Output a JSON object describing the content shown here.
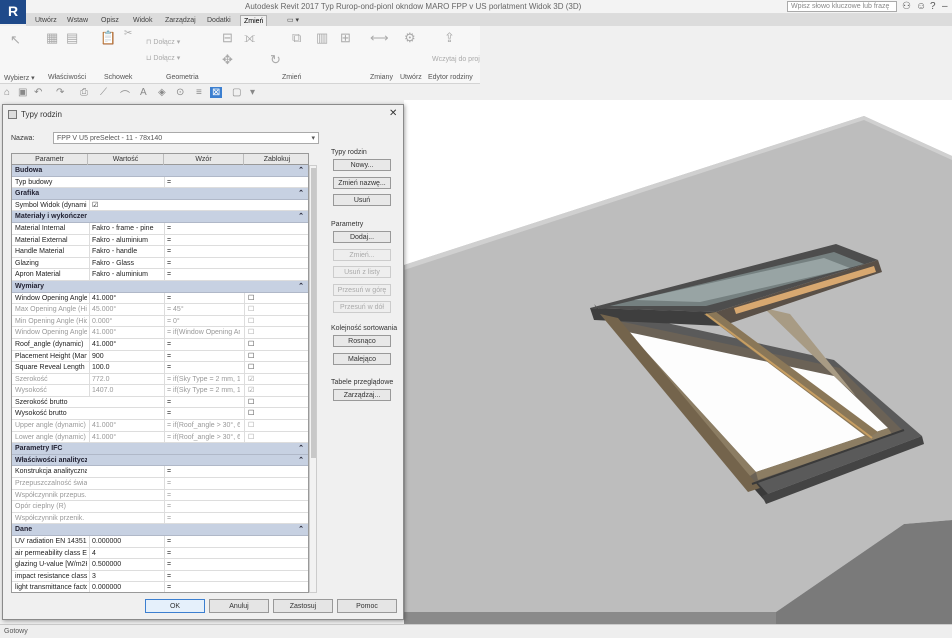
{
  "titlebar": {
    "logo": "R",
    "title": "Autodesk Revit 2017    Typ Rurop-ond-pionl okndow MARO FPP v US porlatment    Widok 3D (3D)",
    "search_placeholder": "Wpisz słowo kluczowe lub frazę"
  },
  "tabs": [
    "Utwórz",
    "Wstaw",
    "Opisz",
    "Widok",
    "Zarządzaj",
    "Dodatki",
    "Zmień"
  ],
  "active_tab": "Zmień",
  "ribbon": {
    "groups": [
      "Wybierz ▾",
      "Właściwości",
      "Schowek",
      "Geometria",
      "Zmień",
      "Zmiany",
      "Utwórz",
      "Edytor rodziny"
    ],
    "small_labels": [
      "Wczytaj do projektu"
    ]
  },
  "dialog": {
    "title": "Typy rodzin",
    "close": "✕",
    "rodzina_label": "Nazwa:",
    "rodzina_value": "FPP V U5 preSelect - 11 - 78x140",
    "headers": [
      "Parametr",
      "Wartość",
      "Wzór",
      "Zablokuj"
    ],
    "rows": [
      {
        "type": "grp",
        "c0": "Budowa"
      },
      {
        "c0": "Typ budowy",
        "c1": "",
        "c2": "="
      },
      {
        "type": "grp",
        "c0": "Grafika"
      },
      {
        "c0": "Symbol Widok (dynamic)",
        "c1": "☑",
        "c2": ""
      },
      {
        "type": "grp",
        "c0": "Materiały i wykończenia"
      },
      {
        "c0": "Material Internal",
        "c1": "Fakro - frame - pine",
        "c2": "="
      },
      {
        "c0": "Material External",
        "c1": "Fakro - aluminium",
        "c2": "="
      },
      {
        "c0": "Handle Material",
        "c1": "Fakro - handle",
        "c2": "="
      },
      {
        "c0": "Glazing",
        "c1": "Fakro - Glass",
        "c2": "="
      },
      {
        "c0": "Apron Material",
        "c1": "Fakro - aluminium",
        "c2": "="
      },
      {
        "type": "grp",
        "c0": "Wymiary"
      },
      {
        "c0": "Window Opening Angle",
        "c1": "41.000°",
        "c2": "=",
        "c3": "☐"
      },
      {
        "c0": "Max Opening Angle (Hidden)",
        "c1": "45.000°",
        "c2": "= 45°",
        "c3": "☐",
        "dim": true
      },
      {
        "c0": "Min Opening Angle (Hidden)",
        "c1": "0.000°",
        "c2": "= 0°",
        "c3": "☐",
        "dim": true
      },
      {
        "c0": "Window Opening Angle 2",
        "c1": "41.000°",
        "c2": "= if(Window Opening Angle",
        "c3": "☐",
        "dim": true
      },
      {
        "c0": "Roof_angle (dynamic)",
        "c1": "41.000°",
        "c2": "=",
        "c3": "☐"
      },
      {
        "c0": "Placement Height (Manual)",
        "c1": "900",
        "c2": "=",
        "c3": "☐"
      },
      {
        "c0": "Square Reveal Length",
        "c1": "100.0",
        "c2": "=",
        "c3": "☐"
      },
      {
        "c0": "Szerokość",
        "c1": "772.0",
        "c2": "= if(Sky Type = 2 mm, 1",
        "c3": "☑",
        "dim": true
      },
      {
        "c0": "Wysokość",
        "c1": "1407.0",
        "c2": "= if(Sky Type = 2 mm, 1",
        "c3": "☑",
        "dim": true
      },
      {
        "c0": "Szerokość brutto",
        "c1": "",
        "c2": "=",
        "c3": "☐"
      },
      {
        "c0": "Wysokość brutto",
        "c1": "",
        "c2": "=",
        "c3": "☐"
      },
      {
        "c0": "Upper angle (dynamic)",
        "c1": "41.000°",
        "c2": "= if(Roof_angle > 30°, 60",
        "c3": "☐",
        "dim": true
      },
      {
        "c0": "Lower angle (dynamic)",
        "c1": "41.000°",
        "c2": "= if(Roof_angle > 30°, 60",
        "c3": "☐",
        "dim": true
      },
      {
        "type": "grp",
        "c0": "Parametry IFC"
      },
      {
        "type": "grp",
        "c0": "Właściwości analityczne"
      },
      {
        "c0": "Konstrukcja analityczna",
        "c1": "",
        "c2": "="
      },
      {
        "c0": "Przepuszczalność światła",
        "c1": "",
        "c2": "=",
        "dim": true
      },
      {
        "c0": "Współczynnik przepus.",
        "c1": "",
        "c2": "=",
        "dim": true
      },
      {
        "c0": "Opór cieplny (R)",
        "c1": "",
        "c2": "=",
        "dim": true
      },
      {
        "c0": "Współczynnik przenik.",
        "c1": "",
        "c2": "=",
        "dim": true
      },
      {
        "type": "grp",
        "c0": "Dane"
      },
      {
        "c0": "UV radiation EN 14351",
        "c1": "0.000000",
        "c2": "="
      },
      {
        "c0": "air permeability class EN",
        "c1": "4",
        "c2": "="
      },
      {
        "c0": "glazing U-value [W/m2K]",
        "c1": "0.500000",
        "c2": "="
      },
      {
        "c0": "impact resistance class",
        "c1": "3",
        "c2": "="
      },
      {
        "c0": "light transmittance factor",
        "c1": "0.000000",
        "c2": "="
      }
    ],
    "sections": [
      {
        "label": "Typy rodzin",
        "buttons": [
          {
            "label": "Nowy...",
            "dis": false
          },
          {
            "label": "Zmień nazwę...",
            "dis": false
          },
          {
            "label": "Usuń",
            "dis": false
          }
        ]
      },
      {
        "label": "Parametry",
        "buttons": [
          {
            "label": "Dodaj...",
            "dis": false
          },
          {
            "label": "Zmień...",
            "dis": true
          },
          {
            "label": "Usuń z listy",
            "dis": true
          },
          {
            "label": "Przesuń w górę",
            "dis": true
          },
          {
            "label": "Przesuń w dół",
            "dis": true
          }
        ]
      },
      {
        "label": "Kolejność sortowania",
        "buttons": [
          {
            "label": "Rosnąco",
            "dis": false
          },
          {
            "label": "Malejąco",
            "dis": false
          }
        ]
      },
      {
        "label": "Tabele przeglądowe",
        "buttons": [
          {
            "label": "Zarządzaj...",
            "dis": false
          }
        ]
      }
    ],
    "bottom_buttons": {
      "ok": "OK",
      "cancel": "Anuluj",
      "apply": "Zastosuj",
      "help": "Pomoc"
    }
  },
  "statusbar": {
    "text": "Gotowy"
  },
  "colors": {
    "accent": "#3c7fd0",
    "group_row": "#c7d1e2",
    "logo": "#1f4a8a"
  }
}
